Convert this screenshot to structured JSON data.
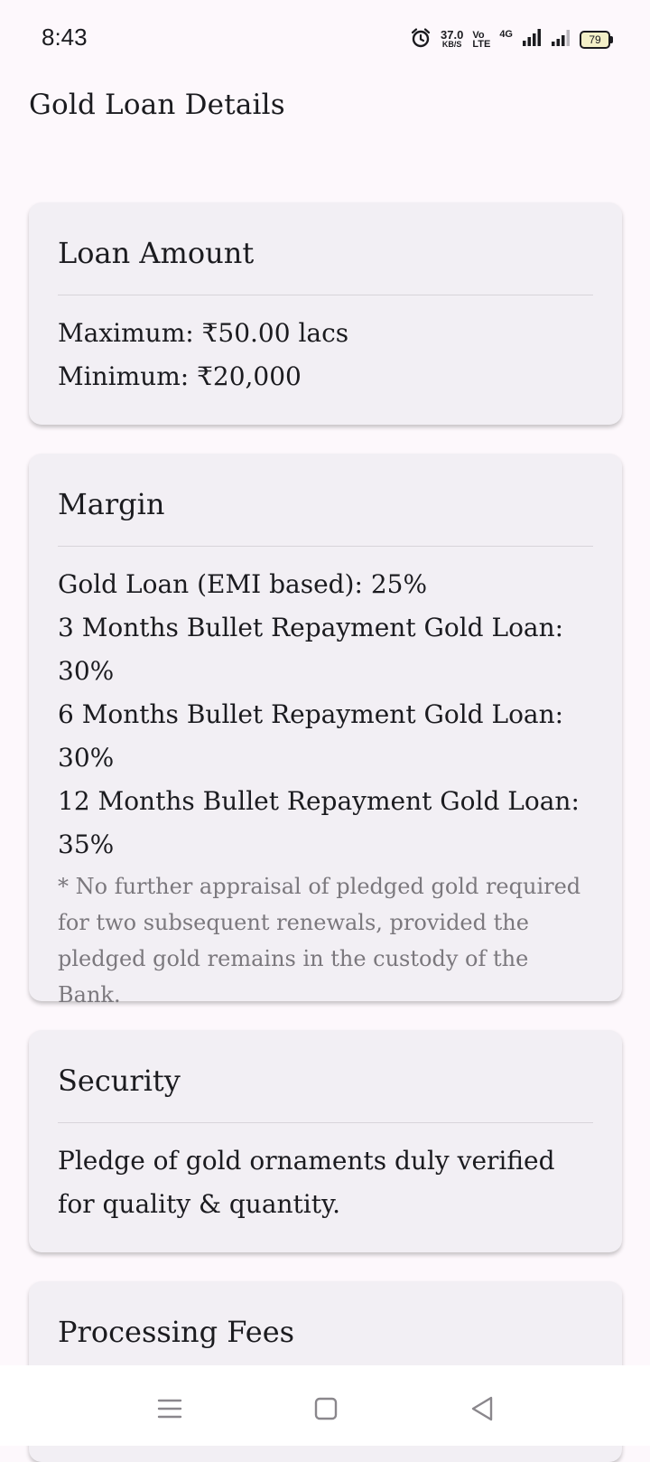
{
  "status_bar": {
    "time": "8:43",
    "net_speed_value": "37.0",
    "net_speed_unit": "KB/S",
    "volte_top": "Vo",
    "volte_bottom": "LTE",
    "network_type": "4G",
    "battery": "79",
    "icons": [
      "alarm-icon",
      "signal-icon",
      "signal-icon",
      "battery-icon"
    ]
  },
  "page": {
    "title": "Gold Loan Details"
  },
  "cards": {
    "loan_amount": {
      "title": "Loan Amount",
      "lines": [
        "Maximum: ₹50.00 lacs",
        "Minimum: ₹20,000"
      ]
    },
    "margin": {
      "title": "Margin",
      "lines": [
        "Gold Loan (EMI based): 25%",
        "3 Months Bullet Repayment Gold Loan: 30%",
        "6 Months Bullet Repayment Gold Loan: 30%",
        "12 Months Bullet Repayment Gold Loan: 35%"
      ],
      "note": "* No further appraisal of pledged gold required for two subsequent renewals, provided the pledged gold remains in the custody of the Bank."
    },
    "security": {
      "title": "Security",
      "text": "Pledge of gold ornaments duly verified for quality & quantity."
    },
    "processing_fees": {
      "title": "Processing Fees"
    }
  },
  "nav": {
    "icons": [
      "menu-icon",
      "home-square-icon",
      "back-triangle-icon"
    ]
  },
  "colors": {
    "background": "#fdf8fc",
    "card": "#f2eff4",
    "text": "#1b1b1f",
    "note_text": "#7b787d",
    "divider": "#d8d4da"
  }
}
